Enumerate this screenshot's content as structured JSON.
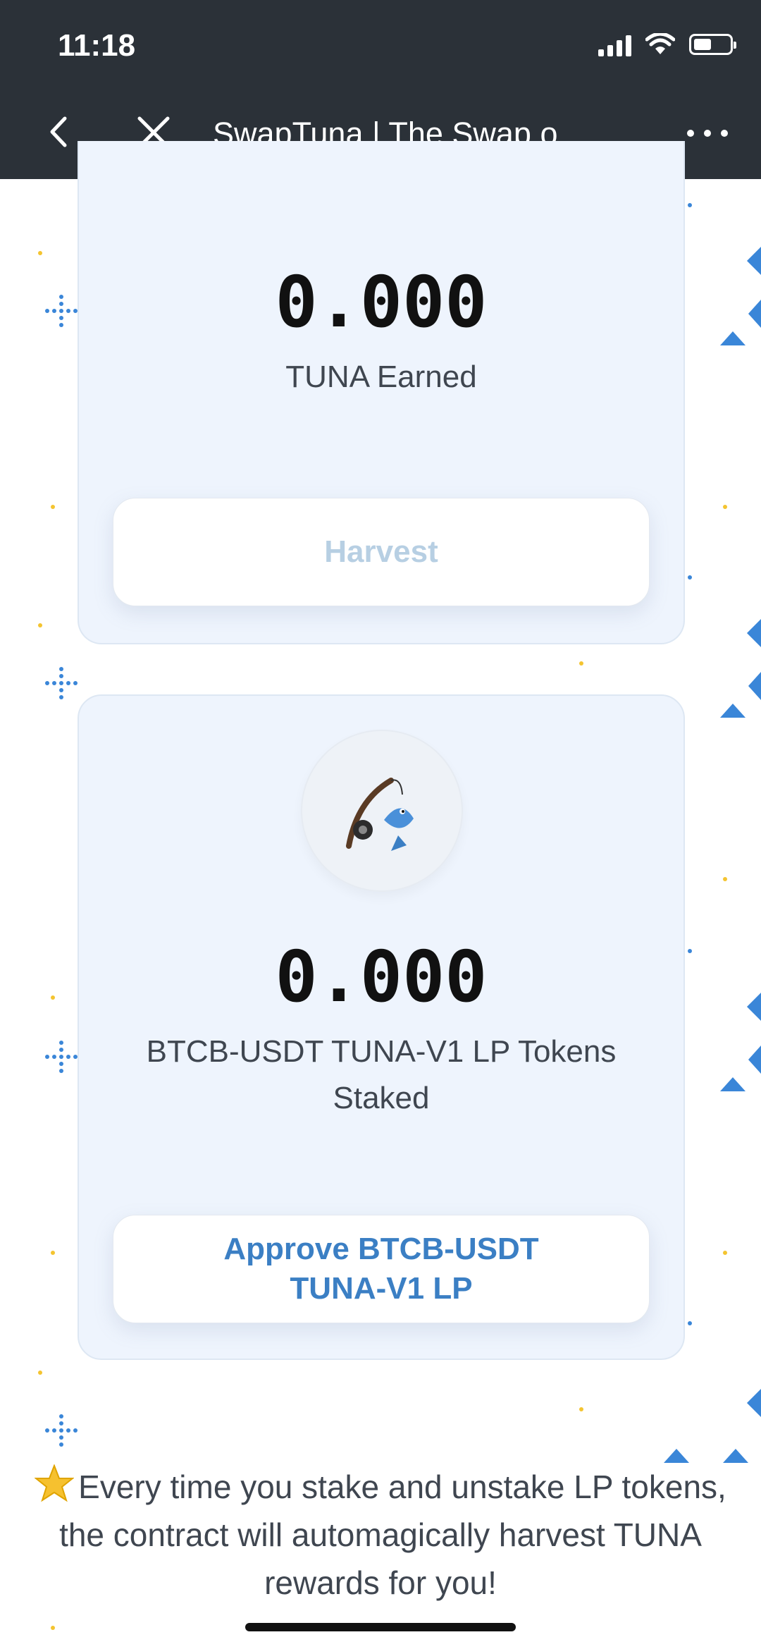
{
  "status_bar": {
    "time": "11:18"
  },
  "nav": {
    "title": "SwapTuna | The Swap o..."
  },
  "card_earned": {
    "amount": "0.000",
    "label": "TUNA Earned",
    "harvest_label": "Harvest"
  },
  "card_staked": {
    "amount": "0.000",
    "label_line1": "BTCB-USDT TUNA-V1 LP Tokens",
    "label_line2": "Staked",
    "approve_line1": "Approve BTCB-USDT",
    "approve_line2": "TUNA-V1 LP",
    "icon": "fishing-rod-fish-icon"
  },
  "footer": {
    "line1": "Every time you stake and unstake LP tokens,",
    "line2": "the contract will automagically harvest TUNA",
    "line3": "rewards for you!",
    "icon": "star-icon"
  },
  "colors": {
    "accent": "#3b7fc4",
    "card_bg": "#eef4fd",
    "topbar": "#2b3138"
  }
}
